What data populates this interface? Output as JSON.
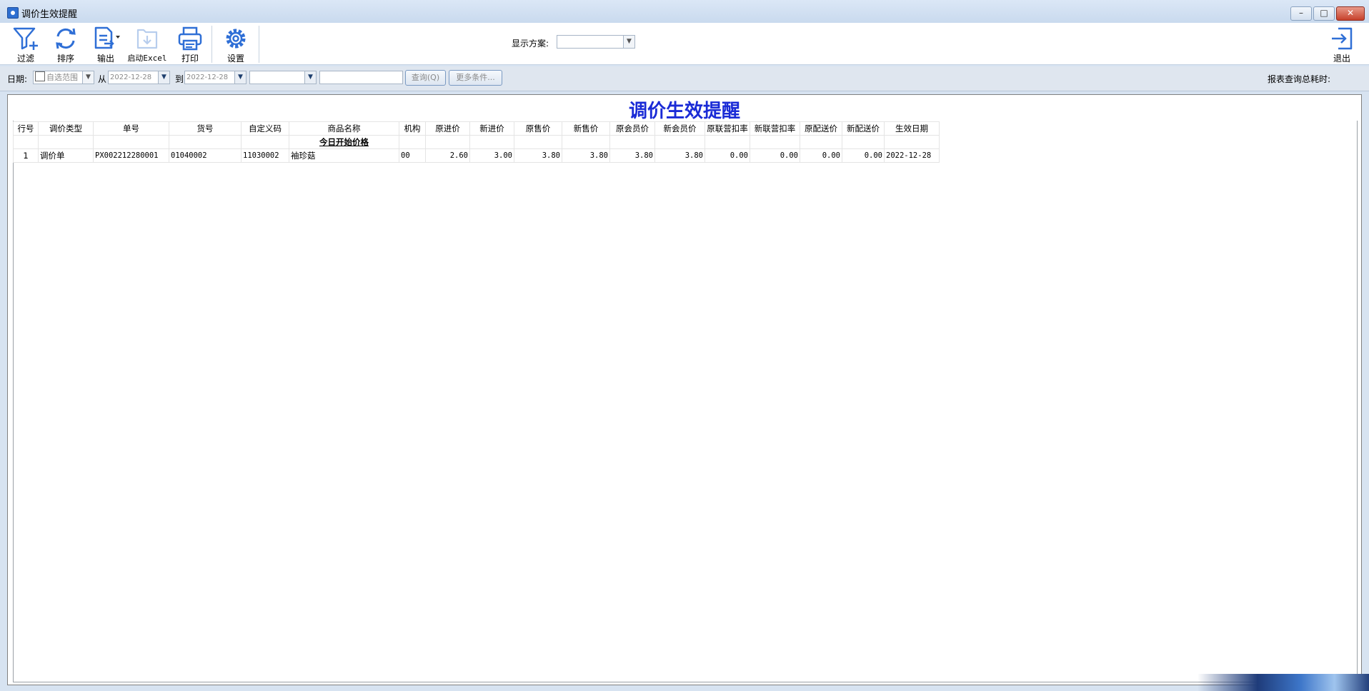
{
  "window": {
    "title": "调价生效提醒"
  },
  "toolbar": {
    "filter": "过滤",
    "sort": "排序",
    "output": "输出",
    "excel": "启动Excel",
    "print": "打印",
    "settings": "设置",
    "exit": "退出",
    "plan_label": "显示方案:",
    "plan_value": ""
  },
  "filterbar": {
    "date_label": "日期:",
    "range_value": "自选范围",
    "from_label": "从",
    "from_date": "2022-12-28",
    "to_label": "到",
    "to_date": "2022-12-28",
    "extra_select": "",
    "extra_input": "",
    "query_button": "查询(Q)",
    "more_button": "更多条件...",
    "elapsed_label": "报表查询总耗时:"
  },
  "report": {
    "title": "调价生效提醒",
    "columns": [
      "行号",
      "调价类型",
      "单号",
      "货号",
      "自定义码",
      "商品名称",
      "机构",
      "原进价",
      "新进价",
      "原售价",
      "新售价",
      "原会员价",
      "新会员价",
      "原联营扣率",
      "新联营扣率",
      "原配送价",
      "新配送价",
      "生效日期"
    ],
    "group_label": "今日开始价格",
    "rows": [
      [
        "1",
        "调价单",
        "PX002212280001",
        "01040002",
        "11030002",
        "袖珍菇",
        "00",
        "2.60",
        "3.00",
        "3.80",
        "3.80",
        "3.80",
        "3.80",
        "0.00",
        "0.00",
        "0.00",
        "0.00",
        "2022-12-28"
      ]
    ]
  }
}
